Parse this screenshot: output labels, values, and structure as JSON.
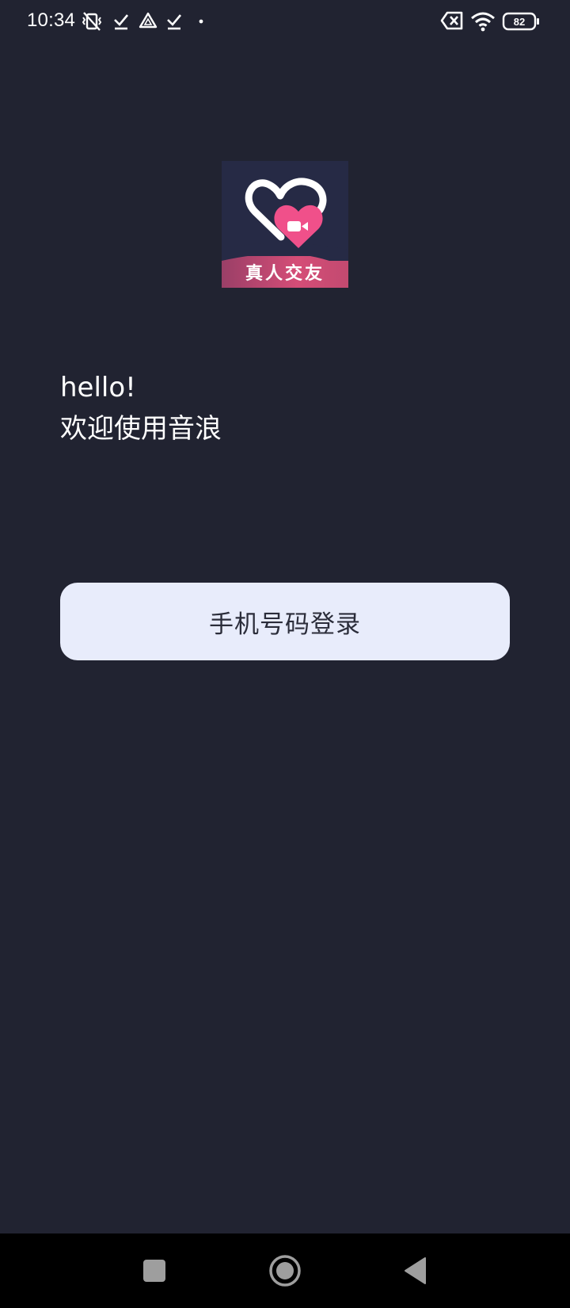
{
  "status_bar": {
    "time": "10:34",
    "battery_level": "82",
    "icons": [
      "mute-vibrate-icon",
      "download-done-icon",
      "drive-icon",
      "download-done-icon",
      "dot-icon",
      "no-sim-icon",
      "wifi-icon",
      "battery-icon"
    ]
  },
  "logo": {
    "text": "真人交友",
    "colors": {
      "background": "#262a45",
      "heart_pink": "#f0508a",
      "band": "#d54d77"
    }
  },
  "greeting": {
    "line1": "hello!",
    "line2": "欢迎使用音浪"
  },
  "login": {
    "label": "手机号码登录"
  },
  "nav_bar": {
    "buttons": [
      "recents-icon",
      "home-icon",
      "back-icon"
    ]
  },
  "colors": {
    "background": "#212331",
    "button_background": "#e8ecfb",
    "button_text": "#2b2d3a"
  }
}
